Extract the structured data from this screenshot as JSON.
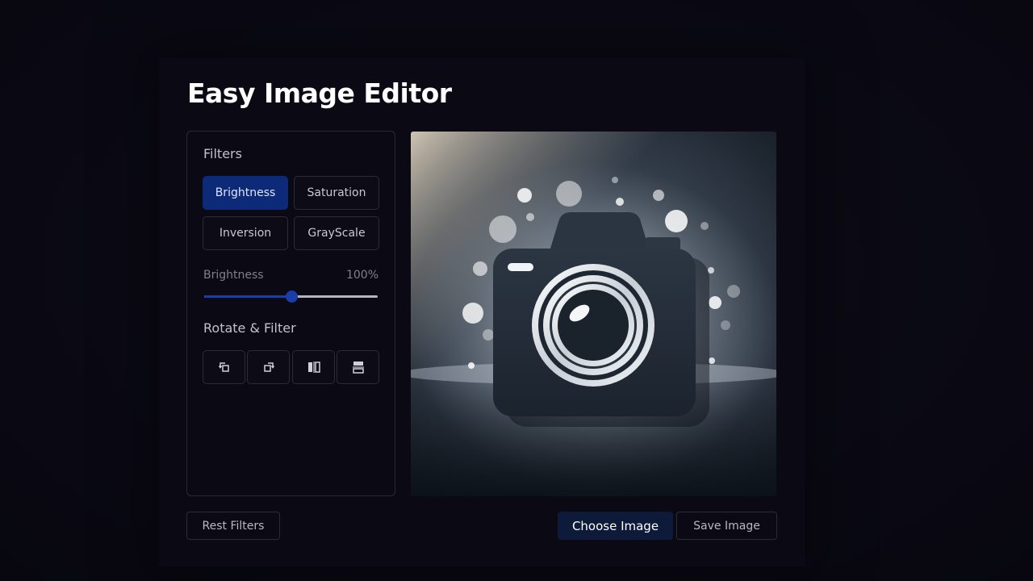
{
  "app": {
    "title": "Easy Image Editor"
  },
  "filters": {
    "heading": "Filters",
    "buttons": [
      "Brightness",
      "Saturation",
      "Inversion",
      "GrayScale"
    ],
    "active": "Brightness"
  },
  "slider": {
    "label": "Brightness",
    "value_text": "100%",
    "fraction": 0.5
  },
  "rotate": {
    "heading": "Rotate & Filter",
    "buttons": [
      "rotate-left-icon",
      "rotate-right-icon",
      "flip-horizontal-icon",
      "flip-vertical-icon"
    ]
  },
  "actions": {
    "reset": "Rest Filters",
    "choose": "Choose Image",
    "save": "Save Image"
  },
  "colors": {
    "accent": "#0c2a78",
    "slider": "#1a3ea8",
    "primary_button": "#0e1a3a"
  }
}
